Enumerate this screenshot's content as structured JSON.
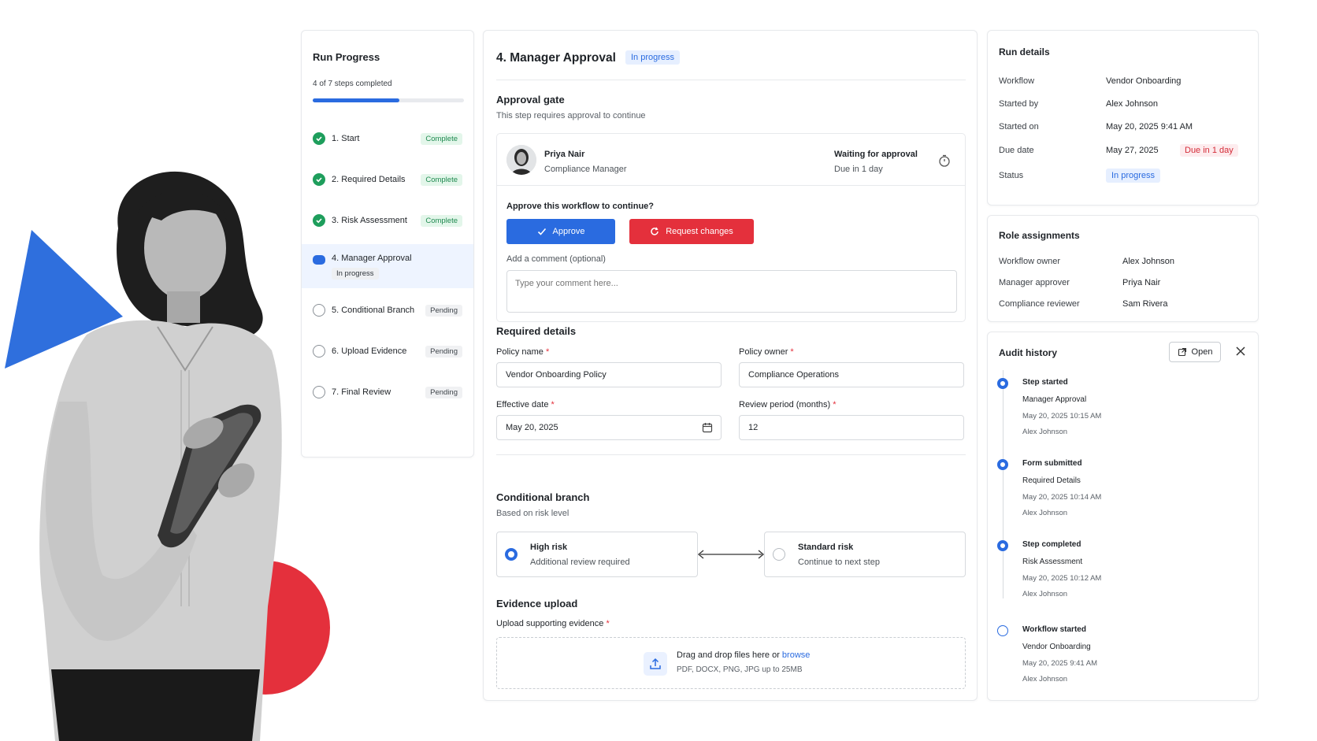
{
  "run_progress": {
    "title": "Run Progress",
    "subtitle": "4 of 7 steps completed",
    "progress_fraction": 0.5714,
    "steps": [
      {
        "label": "1. Start",
        "status": "Complete"
      },
      {
        "label": "2. Required Details",
        "status": "Complete"
      },
      {
        "label": "3. Risk Assessment",
        "status": "Complete"
      },
      {
        "label": "4. Manager Approval",
        "status": "In progress"
      },
      {
        "label": "5. Conditional Branch",
        "status": "Pending"
      },
      {
        "label": "6. Upload Evidence",
        "status": "Pending"
      },
      {
        "label": "7. Final Review",
        "status": "Pending"
      }
    ]
  },
  "main": {
    "title": "4. Manager Approval",
    "status": "In progress",
    "approval_gate": {
      "title": "Approval gate",
      "subtitle": "This step requires approval to continue",
      "approver_name": "Priya Nair",
      "approver_role": "Compliance Manager",
      "wait_title": "Waiting for approval",
      "wait_due": "Due in 1 day",
      "question": "Approve this workflow to continue?",
      "approve_label": "Approve",
      "request_label": "Request changes",
      "comment_label": "Add a comment (optional)",
      "comment_placeholder": "Type your comment here..."
    },
    "required_details": {
      "title": "Required details",
      "policy_name_label": "Policy name",
      "policy_name_value": "Vendor Onboarding Policy",
      "policy_owner_label": "Policy owner",
      "policy_owner_value": "Compliance Operations",
      "effective_date_label": "Effective date",
      "effective_date_value": "May 20, 2025",
      "review_period_label": "Review period (months)",
      "review_period_value": "12",
      "required_mark": "*"
    },
    "conditional_branch": {
      "title": "Conditional branch",
      "subtitle": "Based on risk level",
      "option_high_title": "High risk",
      "option_high_sub": "Additional review required",
      "option_std_title": "Standard risk",
      "option_std_sub": "Continue to next step"
    },
    "evidence_upload": {
      "title": "Evidence upload",
      "label": "Upload supporting evidence",
      "drag_text": "Drag and drop files here or ",
      "browse_link": "browse",
      "hint": "PDF, DOCX, PNG, JPG up to 25MB"
    }
  },
  "run_details": {
    "title": "Run details",
    "rows": [
      {
        "key": "Workflow",
        "value": "Vendor Onboarding"
      },
      {
        "key": "Started by",
        "value": "Alex Johnson"
      },
      {
        "key": "Started on",
        "value": "May 20, 2025 9:41 AM"
      },
      {
        "key": "Due date",
        "value": "May 27, 2025"
      },
      {
        "key": "Status",
        "value": ""
      }
    ],
    "due_badge": "Due in 1 day",
    "status_badge": "In progress"
  },
  "role_assignments": {
    "title": "Role assignments",
    "rows": [
      {
        "key": "Workflow owner",
        "value": "Alex Johnson"
      },
      {
        "key": "Manager approver",
        "value": "Priya Nair"
      },
      {
        "key": "Compliance reviewer",
        "value": "Sam Rivera"
      }
    ]
  },
  "audit_history": {
    "title": "Audit history",
    "open_label": "Open",
    "events": [
      {
        "title": "Step started",
        "subject": "Manager Approval",
        "time": "May 20, 2025 10:15 AM",
        "user": "Alex Johnson"
      },
      {
        "title": "Form submitted",
        "subject": "Required Details",
        "time": "May 20, 2025 10:14 AM",
        "user": "Alex Johnson"
      },
      {
        "title": "Step completed",
        "subject": "Risk Assessment",
        "time": "May 20, 2025 10:12 AM",
        "user": "Alex Johnson"
      },
      {
        "title": "Workflow started",
        "subject": "Vendor Onboarding",
        "time": "May 20, 2025 9:41 AM",
        "user": "Alex Johnson"
      }
    ]
  },
  "colors": {
    "accent_blue": "#2a6be0",
    "danger_red": "#e4303c",
    "success_green": "#1e9e5c"
  }
}
